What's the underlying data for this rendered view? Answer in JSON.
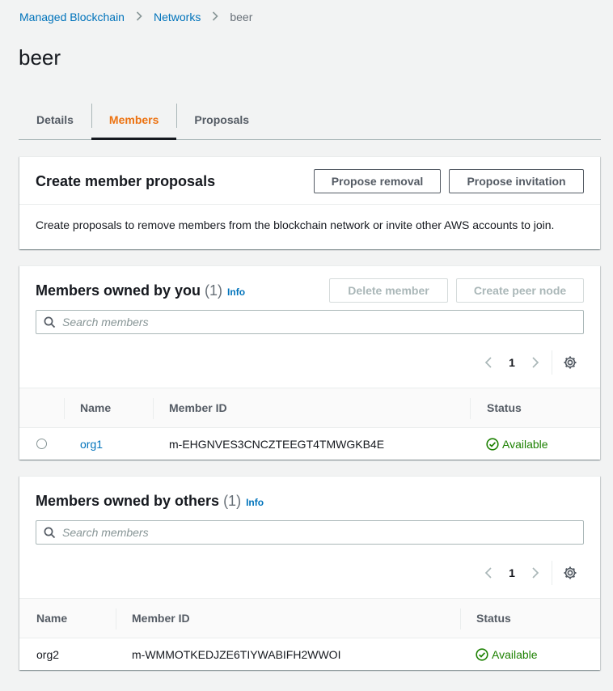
{
  "breadcrumb": {
    "items": [
      "Managed Blockchain",
      "Networks"
    ],
    "current": "beer"
  },
  "page_title": "beer",
  "tabs": [
    {
      "label": "Details",
      "active": false
    },
    {
      "label": "Members",
      "active": true
    },
    {
      "label": "Proposals",
      "active": false
    }
  ],
  "proposals_panel": {
    "title": "Create member proposals",
    "propose_removal_label": "Propose removal",
    "propose_invitation_label": "Propose invitation",
    "description": "Create proposals to remove members from the blockchain network or invite other AWS accounts to join."
  },
  "members_yours": {
    "title": "Members owned by you",
    "count": "(1)",
    "info_label": "Info",
    "delete_label": "Delete member",
    "create_peer_label": "Create peer node",
    "search_placeholder": "Search members",
    "page": "1",
    "columns": [
      "Name",
      "Member ID",
      "Status"
    ],
    "rows": [
      {
        "name": "org1",
        "member_id": "m-EHGNVES3CNCZTEEGT4TMWGKB4E",
        "status": "Available"
      }
    ]
  },
  "members_others": {
    "title": "Members owned by others",
    "count": "(1)",
    "info_label": "Info",
    "search_placeholder": "Search members",
    "page": "1",
    "columns": [
      "Name",
      "Member ID",
      "Status"
    ],
    "rows": [
      {
        "name": "org2",
        "member_id": "m-WMMOTKEDJZE6TIYWABIFH2WWOI",
        "status": "Available"
      }
    ]
  },
  "colors": {
    "link": "#0073bb",
    "active_tab": "#ec7211",
    "success": "#1d8102"
  }
}
